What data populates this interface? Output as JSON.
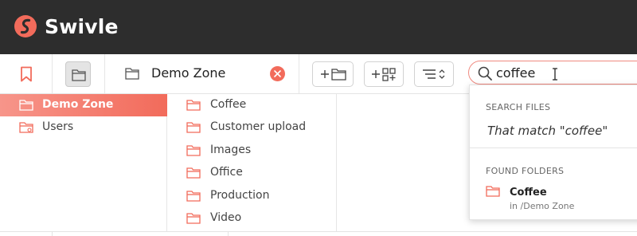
{
  "app": {
    "brand": "Swivle"
  },
  "toolbar": {
    "location_label": "Demo Zone"
  },
  "search": {
    "value": "coffee",
    "placeholder": ""
  },
  "sidebar": {
    "items": [
      {
        "label": "Demo Zone",
        "active": true
      },
      {
        "label": "Users",
        "active": false
      }
    ]
  },
  "folders": {
    "items": [
      "Coffee",
      "Customer upload",
      "Images",
      "Office",
      "Production",
      "Video"
    ]
  },
  "dropdown": {
    "search_files_heading": "SEARCH FILES",
    "match_text": "That match \"coffee\"",
    "found_folders_heading": "FOUND FOLDERS",
    "result": {
      "name": "Coffee",
      "path": "in /Demo Zone"
    }
  },
  "colors": {
    "accent": "#f26b5b",
    "topbar": "#2d2d2d"
  }
}
